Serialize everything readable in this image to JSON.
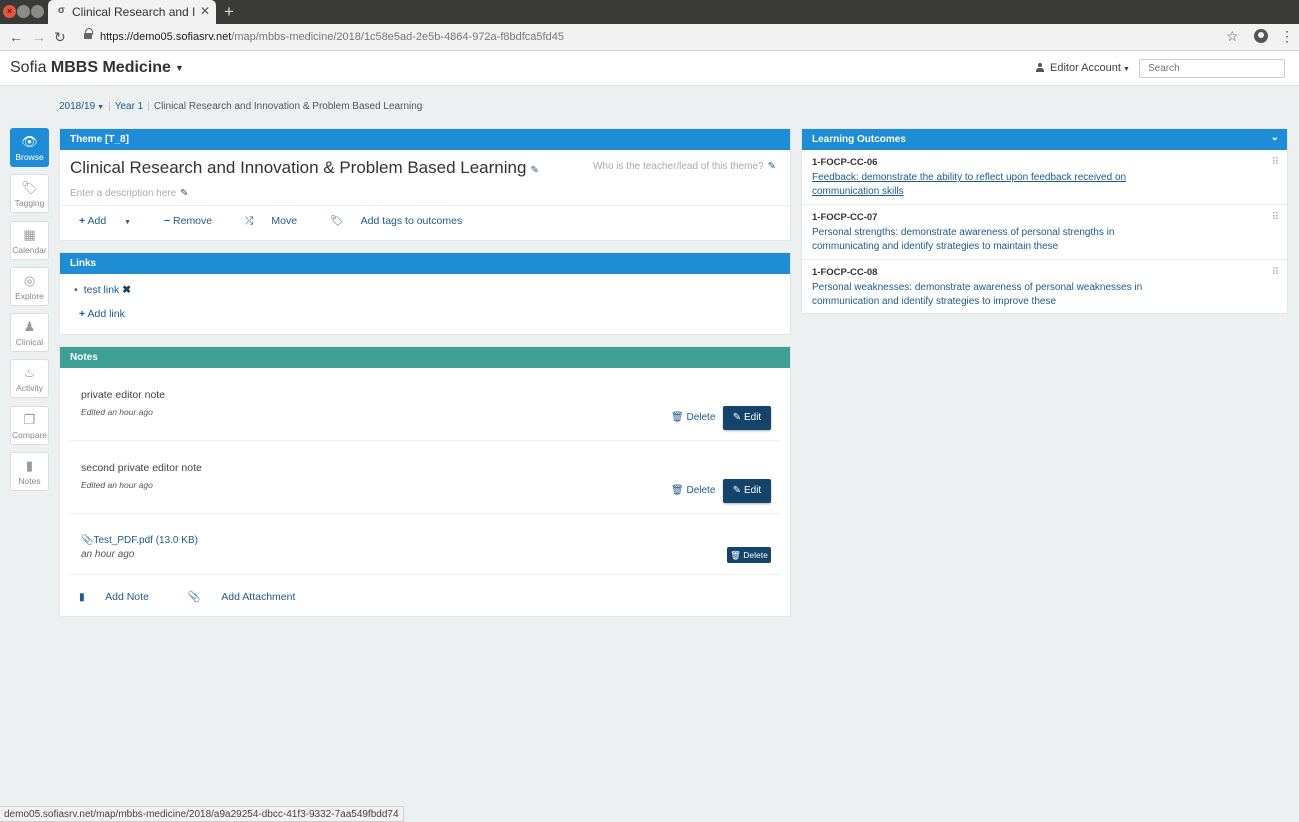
{
  "browser": {
    "tab_title": "Clinical Research and Innovation & Problem Based Learning",
    "tab_favicon": "σ",
    "url_host": "https://demo05.sofiasrv.net",
    "url_path": "/map/mbbs-medicine/2018/1c58e5ad-2e5b-4864-972a-f8bdfca5fd45",
    "status_url": "demo05.sofiasrv.net/map/mbbs-medicine/2018/a9a29254-dbcc-41f3-9332-7aa549fbdd74"
  },
  "header": {
    "brand_light": "Sofia",
    "brand_bold": "MBBS Medicine",
    "account": "Editor Account",
    "search_placeholder": "Search"
  },
  "breadcrumb": {
    "year": "2018/19",
    "level": "Year 1",
    "current": "Clinical Research and Innovation & Problem Based Learning"
  },
  "sidenav": [
    {
      "label": "Browse",
      "icon": "eye-icon",
      "glyph": "👁"
    },
    {
      "label": "Tagging",
      "icon": "tags-icon",
      "glyph": "🏷"
    },
    {
      "label": "Calendar",
      "icon": "calendar-icon",
      "glyph": "▦"
    },
    {
      "label": "Explore",
      "icon": "compass-icon",
      "glyph": "◎"
    },
    {
      "label": "Clinical",
      "icon": "doctor-icon",
      "glyph": "♟"
    },
    {
      "label": "Activity",
      "icon": "flame-icon",
      "glyph": "♨"
    },
    {
      "label": "Compare",
      "icon": "copy-icon",
      "glyph": "❐"
    },
    {
      "label": "Notes",
      "icon": "bookmark-icon",
      "glyph": "▮"
    }
  ],
  "theme": {
    "header": "Theme [T_8]",
    "title": "Clinical Research and Innovation & Problem Based Learning",
    "teacher_prompt": "Who is the teacher/lead of this theme?",
    "description_placeholder": "Enter a description here",
    "actions": {
      "add": "Add",
      "remove": "Remove",
      "move": "Move",
      "tags": "Add tags to outcomes"
    }
  },
  "links": {
    "header": "Links",
    "items": [
      "test link"
    ],
    "add_label": "Add link"
  },
  "notes": {
    "header": "Notes",
    "items": [
      {
        "text": "private editor note",
        "meta": "Edited an hour ago"
      },
      {
        "text": "second private editor note",
        "meta": "Edited an hour ago"
      }
    ],
    "attachment": {
      "name": "Test_PDF.pdf (13.0 KB)",
      "meta": "an hour ago"
    },
    "delete_label": "Delete",
    "edit_label": "Edit",
    "add_note": "Add Note",
    "add_attachment": "Add Attachment"
  },
  "learning_outcomes": {
    "header": "Learning Outcomes",
    "items": [
      {
        "code": "1-FOCP-CC-06",
        "text": "Feedback: demonstrate the ability to reflect upon feedback received on communication skills"
      },
      {
        "code": "1-FOCP-CC-07",
        "text": "Personal strengths: demonstrate awareness of personal strengths in communicating and identify strategies to maintain these"
      },
      {
        "code": "1-FOCP-CC-08",
        "text": "Personal weaknesses: demonstrate awareness of personal weaknesses in communication and identify strategies to improve these"
      }
    ]
  },
  "colors": {
    "primary": "#1f8dd6",
    "notes_header": "#3d9f96",
    "button_dark": "#14436b",
    "link": "#1f5a8a"
  }
}
